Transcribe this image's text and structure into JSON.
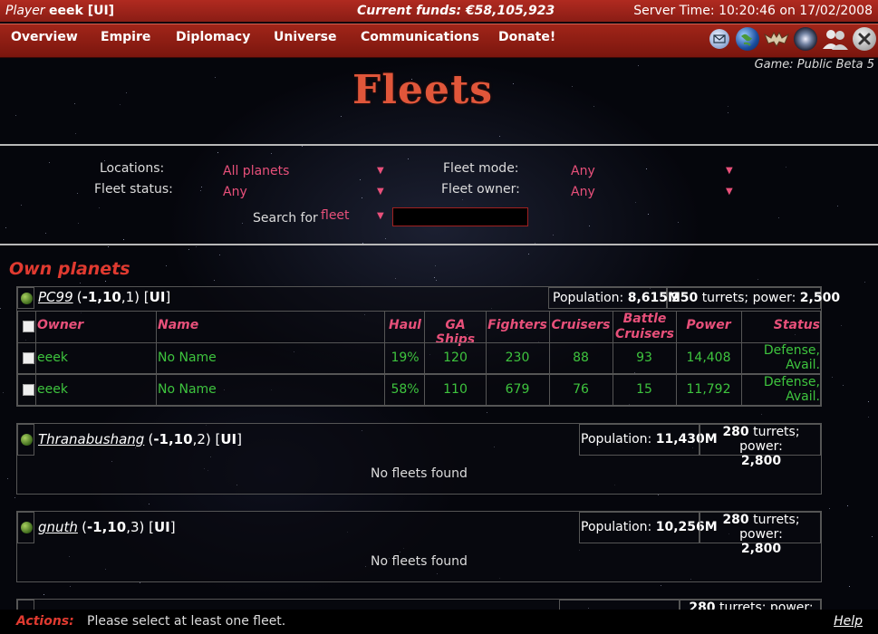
{
  "topbar": {
    "player_label": "Player",
    "player_name": "eeek [UI]",
    "funds_label": "Current funds:",
    "funds_value": "€58,105,923",
    "server_time": "Server Time: 10:20:46 on 17/02/2008"
  },
  "menu": {
    "items": [
      "Overview",
      "Empire",
      "Diplomacy",
      "Universe",
      "Communications",
      "Donate!"
    ],
    "icons": [
      "mail-icon",
      "earth-icon",
      "bat-icon",
      "galaxy-icon",
      "users-icon",
      "close-icon"
    ]
  },
  "game": "Game: Public Beta 5",
  "page_title": "Fleets",
  "filters": {
    "locations_label": "Locations:",
    "locations_value": "All planets",
    "fleet_status_label": "Fleet status:",
    "fleet_status_value": "Any",
    "fleet_mode_label": "Fleet mode:",
    "fleet_mode_value": "Any",
    "fleet_owner_label": "Fleet owner:",
    "fleet_owner_value": "Any",
    "search_label": "Search for",
    "search_value": "fleet",
    "search_input": ""
  },
  "section_title": "Own planets",
  "table_headers": [
    "Owner",
    "Name",
    "Haul",
    "GA Ships",
    "Fighters",
    "Cruisers",
    "Battle Cruisers",
    "Power",
    "Status"
  ],
  "planets": [
    {
      "name": "PC99",
      "coord_prefix": "(",
      "coord_bold": "-1,10",
      "coord_suffix": ",1)",
      "alliance": "UI",
      "pop_label": "Population:",
      "pop_value": "8,615M",
      "turrets_value": "250",
      "turrets_text": "turrets; power:",
      "power_value": "2,500",
      "fleets": [
        {
          "owner": "eeek",
          "name": "No Name",
          "haul": "19%",
          "ga": "120",
          "fighters": "230",
          "cruisers": "88",
          "battle": "93",
          "power": "14,408",
          "status1": "Defense,",
          "status2": "Avail."
        },
        {
          "owner": "eeek",
          "name": "No Name",
          "haul": "58%",
          "ga": "110",
          "fighters": "679",
          "cruisers": "76",
          "battle": "15",
          "power": "11,792",
          "status1": "Defense,",
          "status2": "Avail."
        }
      ]
    },
    {
      "name": "Thranabushang",
      "coord_prefix": "(",
      "coord_bold": "-1,10",
      "coord_suffix": ",2)",
      "alliance": "UI",
      "pop_label": "Population:",
      "pop_value": "11,430M",
      "turrets_value": "280",
      "turrets_text": "turrets; power:",
      "power_value": "2,800",
      "empty_text": "No fleets found"
    },
    {
      "name": "gnuth",
      "coord_prefix": "(",
      "coord_bold": "-1,10",
      "coord_suffix": ",3)",
      "alliance": "UI",
      "pop_label": "Population:",
      "pop_value": "10,256M",
      "turrets_value": "280",
      "turrets_text": "turrets; power:",
      "power_value": "2,800",
      "empty_text": "No fleets found"
    },
    {
      "turrets_value": "280",
      "turrets_text": "turrets; power:"
    }
  ],
  "bottombar": {
    "actions_label": "Actions:",
    "actions_message": "Please select at least one fleet.",
    "help": "Help"
  }
}
